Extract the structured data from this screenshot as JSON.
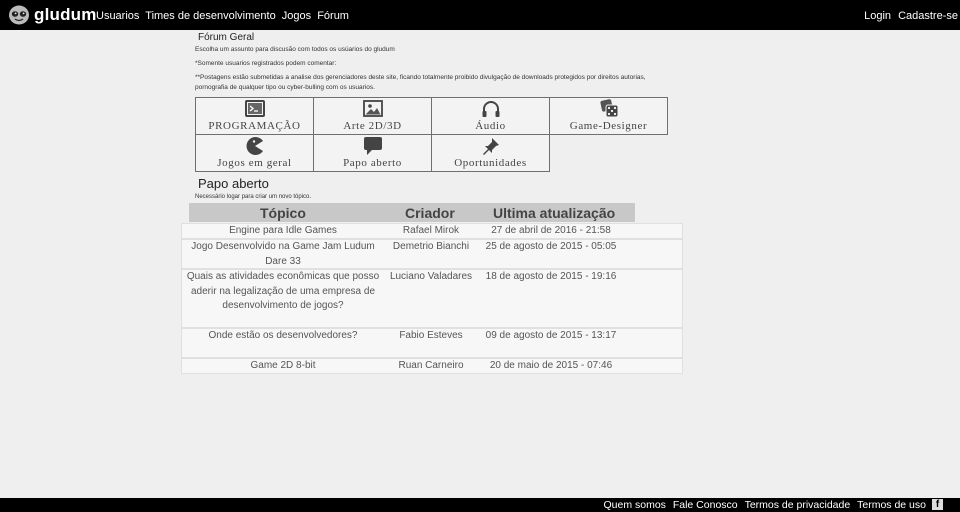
{
  "header": {
    "brand": "gludum",
    "nav": [
      "Usuarios",
      "Times de desenvolvimento",
      "Jogos",
      "Fórum"
    ],
    "auth": [
      "Login",
      "Cadastre-se"
    ]
  },
  "forum": {
    "title": "Fórum Geral",
    "intro1": "Escolha um assunto para discusão com todos os usúarios do gludum",
    "intro2": "*Somente usuarios registrados podem comentar:",
    "intro3": "**Postagens estão submetidas a analise dos gerenciadores deste site, ficando totalmente proibido divulgação de downloads protegidos por direitos autorias, pornografia de qualquer tipo ou cyber-bulling com os usuarios."
  },
  "categories": [
    {
      "label": "PROGRAMAÇÃO",
      "icon": "terminal-icon"
    },
    {
      "label": "Arte  2D/3D",
      "icon": "image-icon"
    },
    {
      "label": "Áudio",
      "icon": "headphones-icon"
    },
    {
      "label": "Game-Designer",
      "icon": "dice-icon"
    },
    {
      "label": "Jogos  em  geral",
      "icon": "pacman-icon"
    },
    {
      "label": "Papo  aberto",
      "icon": "chat-bubble-icon"
    },
    {
      "label": "Oportunidades",
      "icon": "pushpin-icon"
    }
  ],
  "section": {
    "title": "Papo aberto",
    "login_note": "Necessário logar para criar um novo tópico."
  },
  "table": {
    "headers": [
      "Tópico",
      "Criador",
      "Ultima atualização"
    ],
    "rows": [
      {
        "topic": "Engine para Idle Games",
        "creator": "Rafael Mirok",
        "updated": "27 de abril de 2016 - 21:58"
      },
      {
        "topic": "Jogo Desenvolvido na Game Jam Ludum Dare 33",
        "creator": "Demetrio Bianchi",
        "updated": "25 de agosto de 2015 - 05:05"
      },
      {
        "topic": "Quais as atividades econômicas que posso aderir na legalização de uma empresa de desenvolvimento de jogos?",
        "creator": "Luciano  Valadares",
        "updated": "18 de agosto de 2015 - 19:16"
      },
      {
        "topic": "Onde estão os desenvolvedores?",
        "creator": "Fabio Esteves",
        "updated": "09 de agosto de 2015 - 13:17"
      },
      {
        "topic": "Game 2D 8-bit",
        "creator": "Ruan Carneiro",
        "updated": "20 de maio de 2015 - 07:46"
      }
    ]
  },
  "footer": {
    "links": [
      "Quem somos",
      "Fale Conosco",
      "Termos de privacidade",
      "Termos de uso"
    ],
    "social_icon": "facebook-icon",
    "social_glyph": "f"
  },
  "colors": {
    "topbar": "#000000",
    "background": "#efefef",
    "table_header": "#c8c8c8"
  }
}
